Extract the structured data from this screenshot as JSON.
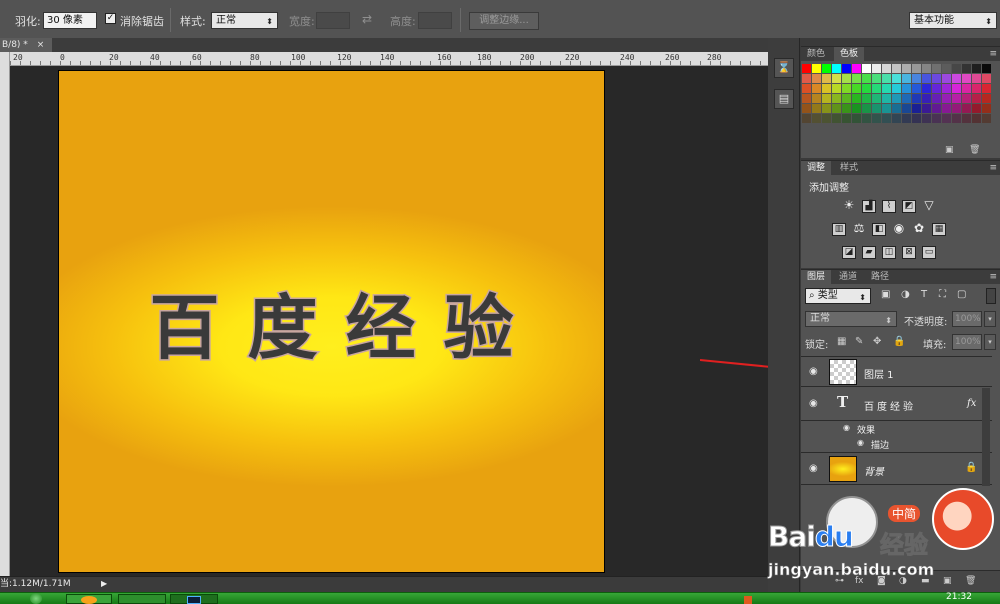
{
  "options_bar": {
    "feather_label": "羽化:",
    "feather_value": "30 像素",
    "antialias_label": "消除锯齿",
    "style_label": "样式:",
    "style_value": "正常",
    "width_label": "宽度:",
    "height_label": "高度:",
    "refine_edge_label": "调整边缘...",
    "workspace_value": "基本功能"
  },
  "document": {
    "tab_label": "B/8) *",
    "tab_close": "×",
    "ruler_ticks": [
      "20",
      "0",
      "20",
      "40",
      "60",
      "80",
      "100",
      "120",
      "140",
      "160",
      "180",
      "200",
      "220",
      "240",
      "260",
      "280"
    ],
    "canvas_text": "百度经验"
  },
  "status_bar": {
    "doc_info": "当:1.12M/1.71M"
  },
  "panels": {
    "swatch_tabs": [
      "颜色",
      "色板"
    ],
    "adjust_tabs": [
      "调整",
      "样式"
    ],
    "adjust_title": "添加调整",
    "layers_tabs": [
      "图层",
      "通道",
      "路径"
    ],
    "filter_kind": "类型",
    "blend_mode": "正常",
    "opacity_label": "不透明度:",
    "opacity_value": "100%",
    "lock_label": "锁定:",
    "fill_label": "填充:",
    "fill_value": "100%",
    "layers": [
      {
        "name": "图层 1"
      },
      {
        "name": "百度经验",
        "fx": "fx"
      },
      {
        "name": "效果"
      },
      {
        "name": "描边"
      },
      {
        "name": "背景"
      }
    ]
  },
  "taskbar": {
    "clock": "21:32"
  },
  "watermark": {
    "brand": "Bai",
    "brand_end": "du",
    "jingyan": "经验",
    "badge": "中简",
    "url": "jingyan.baidu.com"
  },
  "colors": {
    "swatches_row1": [
      "#ff0000",
      "#ffff00",
      "#00ff00",
      "#00ffff",
      "#0000ff",
      "#ff00ff",
      "#ffffff",
      "#ebebeb",
      "#d6d6d6",
      "#c2c2c2",
      "#adadad",
      "#999999",
      "#858585",
      "#707070",
      "#5c5c5c",
      "#474747",
      "#333333",
      "#1f1f1f",
      "#0a0a0a",
      "#000000"
    ],
    "canvas_text": "#3a3a3a",
    "arrow": "#e02020"
  }
}
